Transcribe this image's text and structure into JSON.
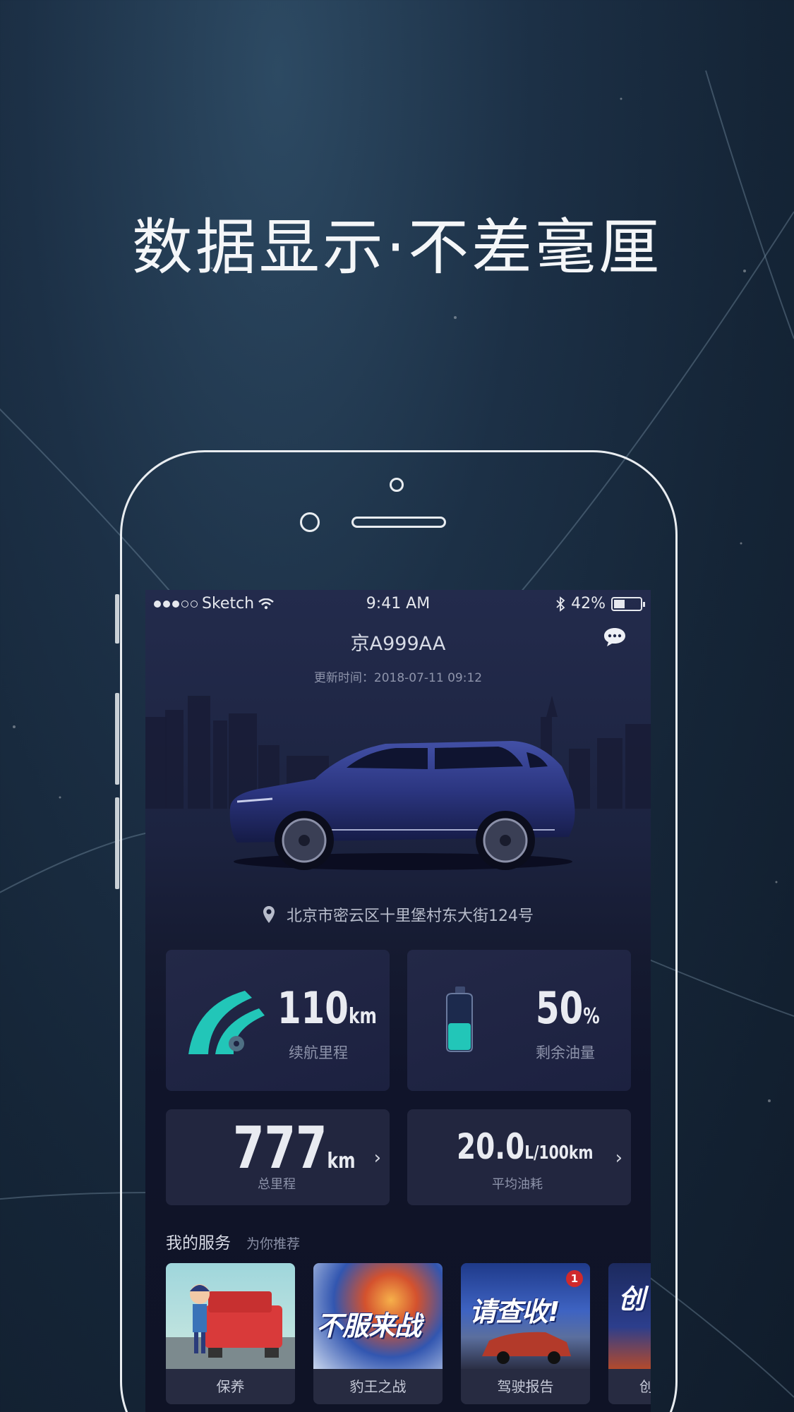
{
  "headline": "数据显示·不差毫厘",
  "status_bar": {
    "carrier": "Sketch",
    "time": "9:41 AM",
    "battery": "42%",
    "battery_level": 0.42
  },
  "vehicle": {
    "plate": "京A999AA",
    "updated": "更新时间：2018-07-11 09:12",
    "location": "北京市密云区十里堡村东大街124号"
  },
  "stats": {
    "range": {
      "value": "110",
      "unit": "km",
      "label": "续航里程"
    },
    "fuel": {
      "value": "50",
      "unit": "%",
      "label": "剩余油量",
      "level": 0.5
    },
    "odometer": {
      "value": "777",
      "unit": "km",
      "label": "总里程"
    },
    "consumption": {
      "value": "20.0",
      "unit": "L/100km",
      "label": "平均油耗"
    }
  },
  "services": {
    "title": "我的服务",
    "subtitle": "为你推荐",
    "items": [
      {
        "label": "保养"
      },
      {
        "label": "豹王之战",
        "banner": "不服来战"
      },
      {
        "label": "驾驶报告",
        "banner": "请查收!",
        "badge": "1"
      },
      {
        "label": "创",
        "banner": "创"
      }
    ]
  },
  "colors": {
    "accent_teal": "#22c6b8",
    "background": "#152537",
    "card": "#22263f"
  }
}
